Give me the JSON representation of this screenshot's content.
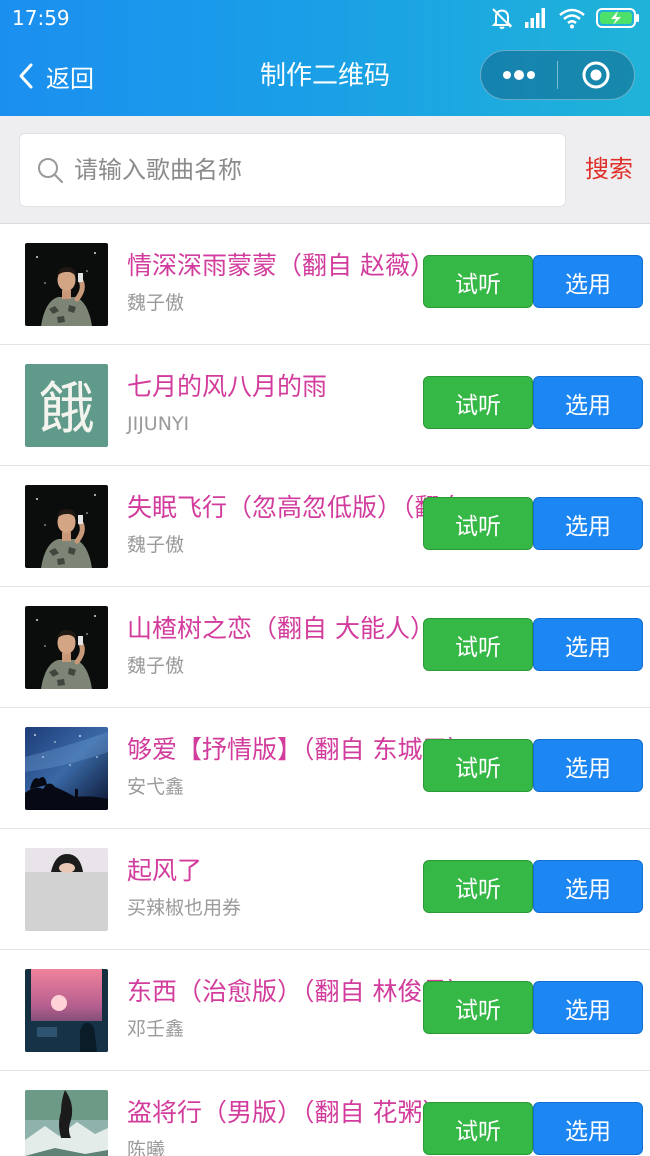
{
  "status": {
    "time": "17:59"
  },
  "nav": {
    "back_label": "返回",
    "title": "制作二维码"
  },
  "search": {
    "placeholder": "请输入歌曲名称",
    "value": "",
    "button_label": "搜索"
  },
  "buttons": {
    "preview_label": "试听",
    "use_label": "选用"
  },
  "songs": [
    {
      "title": "情深深雨蒙蒙（翻自 赵薇）",
      "artist": "魏子傲",
      "cover": "night-portrait",
      "cover_char": ""
    },
    {
      "title": "七月的风八月的雨",
      "artist": "JIJUNYI",
      "cover": "character",
      "cover_char": "餓"
    },
    {
      "title": "失眠飞行（忽高忽低版）（翻自",
      "artist": "魏子傲",
      "cover": "night-portrait",
      "cover_char": ""
    },
    {
      "title": "山楂树之恋（翻自 大能人）",
      "artist": "魏子傲",
      "cover": "night-portrait",
      "cover_char": ""
    },
    {
      "title": "够爱【抒情版】（翻自 东城卫）",
      "artist": "安弋鑫",
      "cover": "starry-sky",
      "cover_char": ""
    },
    {
      "title": "起风了",
      "artist": "买辣椒也用券",
      "cover": "gray-portrait",
      "cover_char": ""
    },
    {
      "title": "东西（治愈版）（翻自 林俊呈）",
      "artist": "邓壬鑫",
      "cover": "sunset-room",
      "cover_char": ""
    },
    {
      "title": "盗将行（男版）（翻自 花粥）",
      "artist": "陈曦",
      "cover": "mountain",
      "cover_char": ""
    }
  ],
  "colors": {
    "header_gradient_start": "#1b8ff0",
    "header_gradient_end": "#20b3d8",
    "title_pink": "#d23c9c",
    "preview_green": "#35b845",
    "use_blue": "#1c86f2",
    "search_red": "#e0302a"
  }
}
